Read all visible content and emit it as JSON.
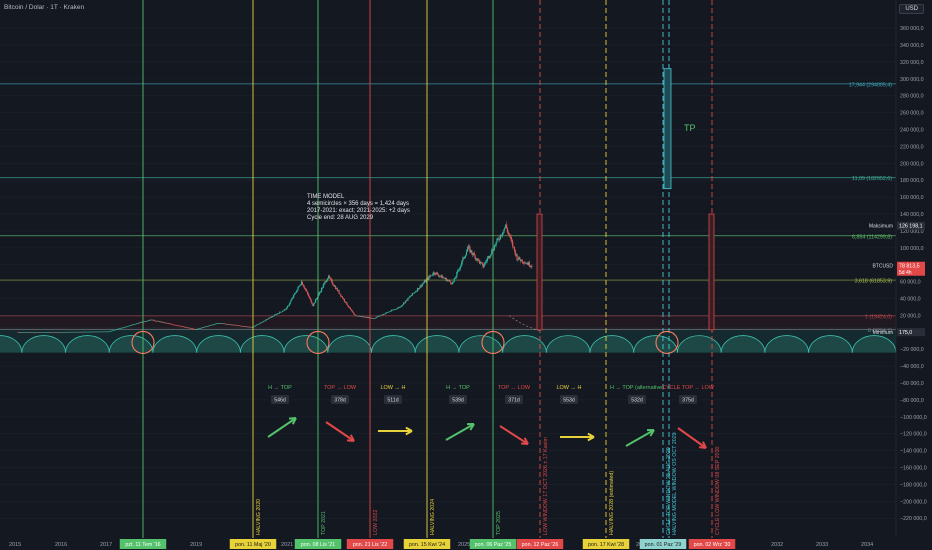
{
  "header": {
    "symbol_label": "Bitcoin / Dolar · 1T · Kraken",
    "currency_button": "USD"
  },
  "annotation_box": {
    "lines": [
      "TIME MODEL",
      "4 semicircles × 356 days = 1,424 days",
      "2017-2021: exact; 2021-2025: +2 days",
      "Cycle end: 28 AUG 2029"
    ]
  },
  "tp_label": "TP",
  "colors": {
    "background": "#141821",
    "grid": "#1f2430",
    "candle_up": "#2bb6a0",
    "candle_down": "#e05a5a",
    "yellow": "#e8d23a",
    "green": "#53c26b",
    "red": "#e24848",
    "cyan": "#48c8d8",
    "semicircle": "#3fc9b7"
  },
  "chart_data": {
    "type": "candlestick",
    "title": "Bitcoin / Dolar · 1T · Kraken",
    "currency": "USD",
    "x_ticks": [
      "2015",
      "2016",
      "2017",
      "2018",
      "2019",
      "2021",
      "2022",
      "2025",
      "2026",
      "2029",
      "2032",
      "2033",
      "2034"
    ],
    "y_ticks": [
      "360 000,0",
      "340 000,0",
      "320 000,0",
      "300 000,0",
      "280 000,0",
      "260 000,0",
      "240 000,0",
      "220 000,0",
      "200 000,0",
      "180 000,0",
      "160 000,0",
      "140 000,0",
      "120 000,0",
      "100 000,0",
      "80 000,0",
      "60 000,0",
      "40 000,0",
      "20 000,0",
      "−20 000,0",
      "−40 000,0",
      "−60 000,0",
      "−80 000,0",
      "−100 000,0",
      "−120 000,0",
      "−140 000,0",
      "−160 000,0",
      "−180 000,0",
      "−200 000,0",
      "−220 000,0"
    ],
    "y_range": [
      -228000,
      372000
    ],
    "fib_levels": [
      {
        "label": "17,944 (294005,4)",
        "value": 294005,
        "color": "#3fa7b8"
      },
      {
        "label": "11,09 (182952,6)",
        "value": 182952,
        "color": "#3fb39a"
      },
      {
        "label": "6,854 (114299,8)",
        "value": 114299,
        "color": "#5ec26b"
      },
      {
        "label": "3,618 (61853,9)",
        "value": 61853,
        "color": "#a8c24a"
      },
      {
        "label": "1 (19424,0)",
        "value": 19424,
        "color": "#e05656"
      },
      {
        "label": "0 (3204,7)",
        "value": 3204,
        "color": "#8a8f9a"
      }
    ],
    "price_tags": [
      {
        "label": "Maksimum",
        "value_text": "126 198,1",
        "value": 126198,
        "color": "#2a2e39"
      },
      {
        "label": "BTCUSD",
        "value_text": "78 813,5",
        "sub_text": "5d 4h",
        "value": 78813,
        "color": "#e24848"
      },
      {
        "label": "Minimum",
        "value_text": "175,0",
        "value": 175,
        "color": "#2a2e39"
      }
    ],
    "vertical_events": [
      {
        "date_label": "pzt. 11 Tem '16",
        "color": "#53c26b",
        "style": "solid",
        "text": ""
      },
      {
        "date_label": "pon. 11 Maj '20",
        "color": "#e8d23a",
        "style": "solid",
        "text": "HALVING 2020"
      },
      {
        "date_label": "pon. 08 Lis '21",
        "color": "#53c26b",
        "style": "solid",
        "text": "TOP 2021"
      },
      {
        "date_label": "pon. 21 Lis '22",
        "color": "#e24848",
        "style": "solid",
        "text": "LOW 2022"
      },
      {
        "date_label": "pon. 15 Kwi '24",
        "color": "#e8d23a",
        "style": "solid",
        "text": "HALVING 2024"
      },
      {
        "date_label": "pon. 06 Paz '25",
        "color": "#53c26b",
        "style": "solid",
        "text": "TOP 2025"
      },
      {
        "date_label": "pon. 12 Paz '26",
        "color": "#e24848",
        "style": "dashed",
        "text": "LOW WINDOW 17 OCT 2026 ± 17 Kasim"
      },
      {
        "date_label": "pon. 17 Kwi '28",
        "color": "#e8d23a",
        "style": "dashed",
        "text": "HALVING 2028 (estimated)"
      },
      {
        "date_label": "pon. 01 Paz '29",
        "color": "#48c8d8",
        "style": "dashed",
        "text": "CYCLE TOP WINDOW 28 AUG 2029"
      },
      {
        "date_label": "",
        "color": "#48c8d8",
        "style": "dashed",
        "text": "HALVING MODEL WINDOW OS OCT 2029"
      },
      {
        "date_label": "pon. 02 Wrz '30",
        "color": "#e24848",
        "style": "dashed",
        "text": "CYCLE LOW WINDOW 08 SEP 2030"
      }
    ],
    "phases": [
      {
        "label": "H → TOP",
        "days": "546d",
        "color": "#53c26b"
      },
      {
        "label": "TOP → LOW",
        "days": "378d",
        "color": "#e24848"
      },
      {
        "label": "LOW → H",
        "days": "511d",
        "color": "#e8d23a"
      },
      {
        "label": "H → TOP",
        "days": "539d",
        "color": "#53c26b"
      },
      {
        "label": "TOP → LOW",
        "days": "371d",
        "color": "#e24848"
      },
      {
        "label": "LOW → H",
        "days": "553d",
        "color": "#e8d23a"
      },
      {
        "label": "H → TOP (alternative)",
        "days": "532d",
        "color": "#53c26b"
      },
      {
        "label": "CYCLE TOP → LOW",
        "days": "375d",
        "color": "#e24848"
      }
    ],
    "semicircle_count": 21,
    "price_series_approx": [
      [
        "2015-01",
        300
      ],
      [
        "2016-01",
        400
      ],
      [
        "2016-07",
        650
      ],
      [
        "2017-01",
        1000
      ],
      [
        "2017-12",
        15000
      ],
      [
        "2018-12",
        3500
      ],
      [
        "2019-06",
        11000
      ],
      [
        "2020-03",
        6000
      ],
      [
        "2020-12",
        28000
      ],
      [
        "2021-04",
        60000
      ],
      [
        "2021-07",
        32000
      ],
      [
        "2021-11",
        66000
      ],
      [
        "2022-06",
        20000
      ],
      [
        "2022-11",
        16500
      ],
      [
        "2023-06",
        30000
      ],
      [
        "2024-03",
        71000
      ],
      [
        "2024-08",
        58000
      ],
      [
        "2024-12",
        100000
      ],
      [
        "2025-04",
        78000
      ],
      [
        "2025-10",
        126000
      ],
      [
        "2026-01",
        88000
      ],
      [
        "2026-05",
        78800
      ]
    ]
  }
}
